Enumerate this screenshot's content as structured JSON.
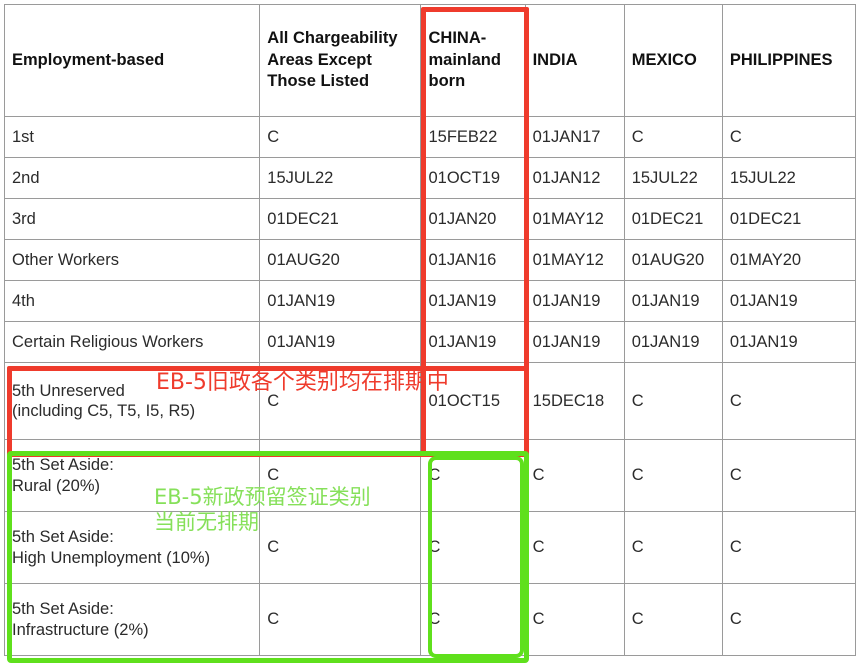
{
  "table": {
    "columns": [
      {
        "key": "category",
        "label": "Employment-based"
      },
      {
        "key": "all_areas",
        "label": "All Chargeability Areas Except Those Listed"
      },
      {
        "key": "china",
        "label": "CHINA-mainland born"
      },
      {
        "key": "india",
        "label": "INDIA"
      },
      {
        "key": "mexico",
        "label": "MEXICO"
      },
      {
        "key": "philippines",
        "label": "PHILIPPINES"
      }
    ],
    "header": {
      "category": "Employment-based",
      "all_areas_l1": "All Chargeability",
      "all_areas_l2": "Areas Except",
      "all_areas_l3": "Those Listed",
      "china_l1": "CHINA-",
      "china_l2": "mainland",
      "china_l3": "born",
      "india": "INDIA",
      "mexico": "MEXICO",
      "philippines": "PHILIPPINES"
    },
    "rows": [
      {
        "id": "eb1",
        "category": "1st",
        "all_areas": "C",
        "china": "15FEB22",
        "india": "01JAN17",
        "mexico": "C",
        "philippines": "C"
      },
      {
        "id": "eb2",
        "category": "2nd",
        "all_areas": "15JUL22",
        "china": "01OCT19",
        "india": "01JAN12",
        "mexico": "15JUL22",
        "philippines": "15JUL22"
      },
      {
        "id": "eb3",
        "category": "3rd",
        "all_areas": "01DEC21",
        "china": "01JAN20",
        "india": "01MAY12",
        "mexico": "01DEC21",
        "philippines": "01DEC21"
      },
      {
        "id": "other-workers",
        "category": "Other Workers",
        "all_areas": "01AUG20",
        "china": "01JAN16",
        "india": "01MAY12",
        "mexico": "01AUG20",
        "philippines": "01MAY20"
      },
      {
        "id": "eb4",
        "category": "4th",
        "all_areas": "01JAN19",
        "china": "01JAN19",
        "india": "01JAN19",
        "mexico": "01JAN19",
        "philippines": "01JAN19"
      },
      {
        "id": "certain-religious-workers",
        "category": "Certain Religious Workers",
        "all_areas": "01JAN19",
        "china": "01JAN19",
        "india": "01JAN19",
        "mexico": "01JAN19",
        "philippines": "01JAN19"
      },
      {
        "id": "eb5-unreserved",
        "category_l1": "5th Unreserved",
        "category_l2": "(including C5, T5, I5, R5)",
        "all_areas": "C",
        "china": "01OCT15",
        "india": "15DEC18",
        "mexico": "C",
        "philippines": "C"
      },
      {
        "id": "eb5-set-aside-rural",
        "category_l1": "5th Set Aside:",
        "category_l2": "Rural (20%)",
        "all_areas": "C",
        "china": "C",
        "india": "C",
        "mexico": "C",
        "philippines": "C"
      },
      {
        "id": "eb5-set-aside-high-unemployment",
        "category_l1": "5th Set Aside:",
        "category_l2": "High Unemployment (10%)",
        "all_areas": "C",
        "china": "C",
        "india": "C",
        "mexico": "C",
        "philippines": "C"
      },
      {
        "id": "eb5-set-aside-infrastructure",
        "category_l1": "5th Set Aside:",
        "category_l2": "Infrastructure (2%)",
        "all_areas": "C",
        "china": "C",
        "india": "C",
        "mexico": "C",
        "philippines": "C"
      }
    ]
  },
  "annotations": {
    "red": {
      "color": "#ef3b2c",
      "text": "EB-5旧政各个类别均在排期中"
    },
    "green": {
      "color": "#86e05a",
      "box_color": "#5fe01c",
      "line1": "EB-5新政预留签证类别",
      "line2": "当前无排期"
    }
  }
}
